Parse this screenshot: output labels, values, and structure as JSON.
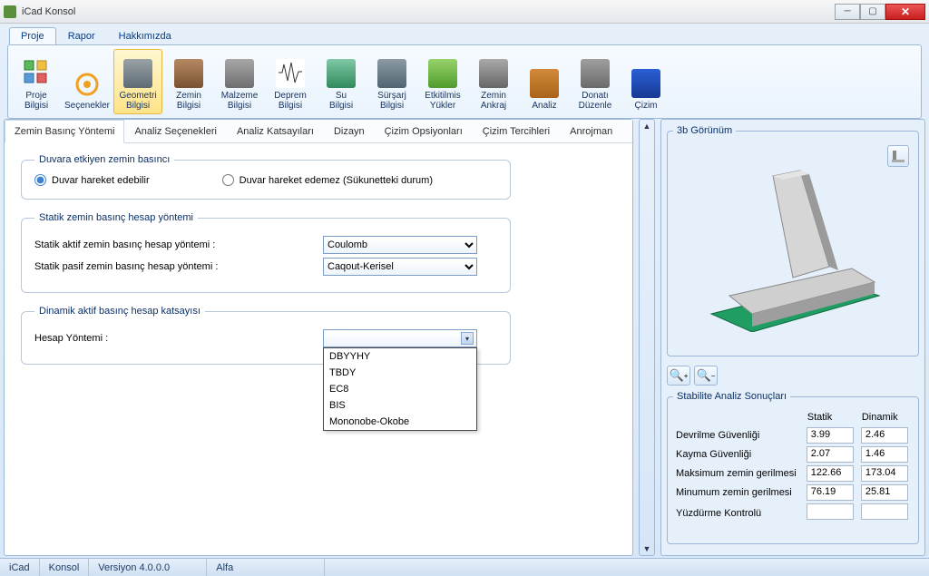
{
  "window": {
    "title": "iCad Konsol"
  },
  "menu": {
    "items": [
      "Proje",
      "Rapor",
      "Hakkımızda"
    ],
    "active": 0
  },
  "ribbon": {
    "buttons": [
      {
        "label": "Proje Bilgisi",
        "icon": "proje"
      },
      {
        "label": "Seçenekler",
        "icon": "sec"
      },
      {
        "label": "Geometri Bilgisi",
        "icon": "geo",
        "selected": true
      },
      {
        "label": "Zemin Bilgisi",
        "icon": "zemin"
      },
      {
        "label": "Malzeme Bilgisi",
        "icon": "malz"
      },
      {
        "label": "Deprem Bilgisi",
        "icon": "dep"
      },
      {
        "label": "Su Bilgisi",
        "icon": "su"
      },
      {
        "label": "Sürşarj Bilgisi",
        "icon": "sur"
      },
      {
        "label": "Etkitilmis Yükler",
        "icon": "etk"
      },
      {
        "label": "Zemin Ankraj",
        "icon": "zank"
      },
      {
        "label": "Analiz",
        "icon": "anlz"
      },
      {
        "label": "Donatı Düzenle",
        "icon": "don"
      },
      {
        "label": "Çizim",
        "icon": "ciz"
      }
    ]
  },
  "subtabs": {
    "items": [
      "Zemin Basınç Yöntemi",
      "Analiz Seçenekleri",
      "Analiz Katsayıları",
      "Dizayn",
      "Çizim Opsiyonları",
      "Çizim Tercihleri",
      "Anrojman"
    ],
    "active": 0
  },
  "groups": {
    "g1": {
      "title": "Duvara etkiyen zemin basıncı",
      "opt1": "Duvar hareket edebilir",
      "opt2": "Duvar hareket edemez (Sükunetteki durum)"
    },
    "g2": {
      "title": "Statik zemin basınç hesap yöntemi",
      "row1_label": "Statik aktif zemin basınç hesap yöntemi :",
      "row1_value": "Coulomb",
      "row2_label": "Statik pasif zemin basınç hesap yöntemi :",
      "row2_value": "Caqout-Kerisel"
    },
    "g3": {
      "title": "Dinamik aktif basınç hesap katsayısı",
      "row1_label": "Hesap Yöntemi :",
      "row1_value": "",
      "options": [
        "DBYYHY",
        "TBDY",
        "EC8",
        "BIS",
        "Mononobe-Okobe"
      ]
    }
  },
  "right": {
    "view_title": "3b Görünüm",
    "stab_title": "Stabilite Analiz Sonuçları",
    "col1": "Statik",
    "col2": "Dinamik",
    "rows": [
      {
        "label": "Devrilme Güvenliği",
        "v1": "3.99",
        "v2": "2.46"
      },
      {
        "label": "Kayma Güvenliği",
        "v1": "2.07",
        "v2": "1.46"
      },
      {
        "label": "Maksimum zemin gerilmesi",
        "v1": "122.66",
        "v2": "173.04"
      },
      {
        "label": "Minumum zemin gerilmesi",
        "v1": "76.19",
        "v2": "25.81"
      },
      {
        "label": "Yüzdürme Kontrolü",
        "v1": "",
        "v2": ""
      }
    ]
  },
  "status": {
    "s1": "iCad",
    "s2": "Konsol",
    "s3": "Versiyon 4.0.0.0",
    "s4": "Alfa"
  }
}
